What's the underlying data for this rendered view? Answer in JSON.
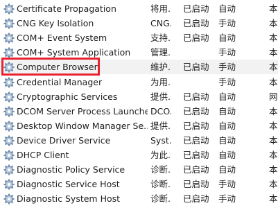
{
  "services": [
    {
      "name": "Certificate Propagation",
      "desc": "将用...",
      "status": "已启动",
      "startup": "自动",
      "logon": "本"
    },
    {
      "name": "CNG Key Isolation",
      "desc": "CNG...",
      "status": "已启动",
      "startup": "手动",
      "logon": "本"
    },
    {
      "name": "COM+ Event System",
      "desc": "支持...",
      "status": "已启动",
      "startup": "自动",
      "logon": "本"
    },
    {
      "name": "COM+ System Application",
      "desc": "管理...",
      "status": "",
      "startup": "手动",
      "logon": "本"
    },
    {
      "name": "Computer Browser",
      "desc": "维护...",
      "status": "已启动",
      "startup": "手动",
      "logon": "本"
    },
    {
      "name": "Credential Manager",
      "desc": "为用...",
      "status": "",
      "startup": "手动",
      "logon": "本"
    },
    {
      "name": "Cryptographic Services",
      "desc": "提供...",
      "status": "已启动",
      "startup": "自动",
      "logon": "网"
    },
    {
      "name": "DCOM Server Process Launcher",
      "desc": "DCO...",
      "status": "已启动",
      "startup": "自动",
      "logon": "本"
    },
    {
      "name": "Desktop Window Manager Se...",
      "desc": "提供...",
      "status": "已启动",
      "startup": "自动",
      "logon": "本"
    },
    {
      "name": "Device Driver Service",
      "desc": "Syst...",
      "status": "已启动",
      "startup": "自动",
      "logon": "本"
    },
    {
      "name": "DHCP Client",
      "desc": "为此...",
      "status": "已启动",
      "startup": "自动",
      "logon": "本"
    },
    {
      "name": "Diagnostic Policy Service",
      "desc": "诊断...",
      "status": "已启动",
      "startup": "自动",
      "logon": "本"
    },
    {
      "name": "Diagnostic Service Host",
      "desc": "诊断...",
      "status": "已启动",
      "startup": "手动",
      "logon": "本"
    },
    {
      "name": "Diagnostic System Host",
      "desc": "诊断...",
      "status": "已启动",
      "startup": "手动",
      "logon": "本"
    }
  ],
  "selected_service": "Computer Browser",
  "highlight_color": "#e8232f",
  "icon": "gear-icon"
}
